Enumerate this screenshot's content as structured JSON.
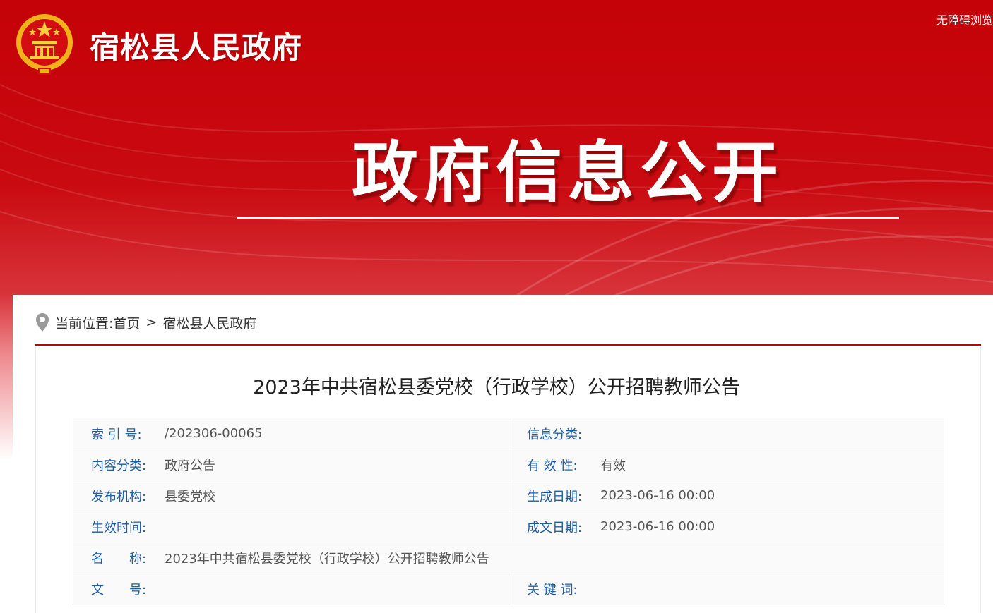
{
  "colors": {
    "brand_red": "#c40208",
    "label_blue": "#1f5ea8",
    "rule_red": "#b5060d"
  },
  "topbar": {
    "accessibility_link": "无障碍浏览"
  },
  "header": {
    "site_name": "宿松县人民政府",
    "banner_title": "政府信息公开"
  },
  "breadcrumb": {
    "prefix": "当前位置:",
    "items": [
      "首页",
      "宿松县人民政府"
    ],
    "separator": ">"
  },
  "article": {
    "title": "2023年中共宿松县委党校（行政学校）公开招聘教师公告",
    "meta": {
      "index_label": "索 引 号:",
      "index_value": "/202306-00065",
      "category_label": "信息分类:",
      "category_value": "",
      "content_type_label": "内容分类:",
      "content_type_value": "政府公告",
      "validity_label": "有 效 性:",
      "validity_value": "有效",
      "publisher_label": "发布机构:",
      "publisher_value": "县委党校",
      "created_label": "生成日期:",
      "created_value": "2023-06-16 00:00",
      "effective_label": "生效时间:",
      "effective_value": "",
      "written_label": "成文日期:",
      "written_value": "2023-06-16 00:00",
      "name_label": "名　　称:",
      "name_value": "2023年中共宿松县委党校（行政学校）公开招聘教师公告",
      "doc_no_label": "文　　号:",
      "doc_no_value": "",
      "keywords_label": "关 键 词:",
      "keywords_value": ""
    }
  }
}
